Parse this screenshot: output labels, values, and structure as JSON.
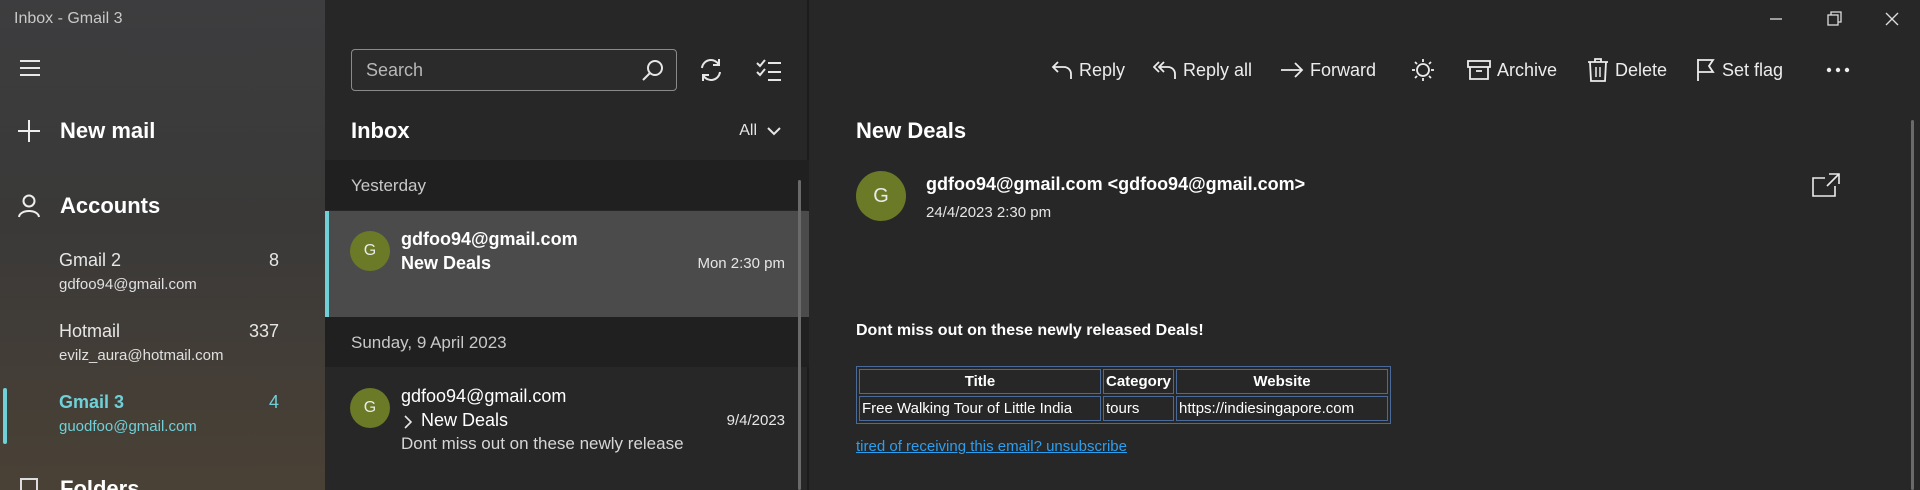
{
  "window": {
    "title": "Inbox - Gmail 3"
  },
  "sidebar": {
    "new_mail_label": "New mail",
    "accounts_label": "Accounts",
    "accounts": [
      {
        "name": "Gmail 2",
        "email": "gdfoo94@gmail.com",
        "count": "8"
      },
      {
        "name": "Hotmail",
        "email": "evilz_aura@hotmail.com",
        "count": "337"
      },
      {
        "name": "Gmail 3",
        "email": "guodfoo@gmail.com",
        "count": "4"
      }
    ],
    "folders_label": "Folders"
  },
  "list": {
    "search_placeholder": "Search",
    "title": "Inbox",
    "filter_label": "All",
    "groups": [
      {
        "label": "Yesterday"
      },
      {
        "label": "Sunday, 9 April 2023"
      }
    ],
    "messages": [
      {
        "avatar": "G",
        "from": "gdfoo94@gmail.com",
        "subject": "New Deals",
        "date": "Mon 2:30 pm",
        "preview": ""
      },
      {
        "avatar": "G",
        "from": "gdfoo94@gmail.com",
        "subject": "New Deals",
        "date": "9/4/2023",
        "preview": "Dont miss out on these newly release"
      }
    ]
  },
  "toolbar": {
    "reply": "Reply",
    "reply_all": "Reply all",
    "forward": "Forward",
    "archive": "Archive",
    "delete": "Delete",
    "set_flag": "Set flag"
  },
  "reader": {
    "subject": "New Deals",
    "avatar": "G",
    "sender": "gdfoo94@gmail.com <gdfoo94@gmail.com>",
    "date": "24/4/2023 2:30 pm",
    "body_heading": "Dont miss out on these newly released Deals!",
    "table": {
      "headers": [
        "Title",
        "Category",
        "Website"
      ],
      "rows": [
        [
          "Free Walking Tour of Little India",
          "tours",
          "https://indiesingapore.com"
        ]
      ]
    },
    "unsubscribe": "tired of receiving this email? unsubscribe"
  },
  "colors": {
    "accent": "#6fd0d8",
    "avatar": "#6b7a27",
    "link": "#2c9ef0"
  }
}
